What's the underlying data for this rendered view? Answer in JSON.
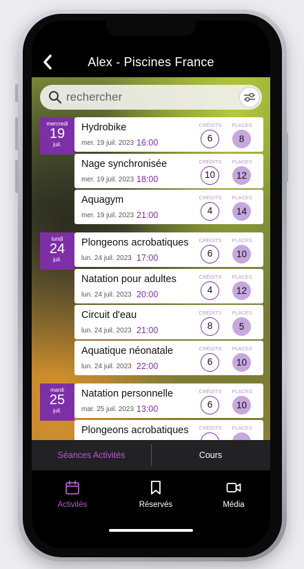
{
  "app": {
    "title": "Alex - Piscines France"
  },
  "search": {
    "placeholder": "rechercher",
    "value": ""
  },
  "labels": {
    "credits": "CRÉDITS",
    "places": "PLACES"
  },
  "days": [
    {
      "dow": "mercredi",
      "day": "19",
      "month": "juil.",
      "sessions": [
        {
          "name": "Hydrobike",
          "date": "mer. 19 juil. 2023",
          "time": "16:00",
          "credits": "6",
          "places": "8"
        },
        {
          "name": "Nage synchronisée",
          "date": "mer. 19 juil. 2023",
          "time": "18:00",
          "credits": "10",
          "places": "12"
        },
        {
          "name": "Aquagym",
          "date": "mer. 19 juil. 2023",
          "time": "21:00",
          "credits": "4",
          "places": "14"
        }
      ]
    },
    {
      "dow": "lundi",
      "day": "24",
      "month": "juil.",
      "sessions": [
        {
          "name": "Plongeons acrobatiques",
          "date": "lun. 24 juil. 2023",
          "time": "17:00",
          "credits": "6",
          "places": "10"
        },
        {
          "name": "Natation pour adultes",
          "date": "lun. 24 juil. 2023",
          "time": "20:00",
          "credits": "4",
          "places": "12"
        },
        {
          "name": "Circuit d'eau",
          "date": "lun. 24 juil. 2023",
          "time": "21:00",
          "credits": "8",
          "places": "5"
        },
        {
          "name": "Aquatique néonatale",
          "date": "lun. 24 juil. 2023",
          "time": "22:00",
          "credits": "6",
          "places": "10"
        }
      ]
    },
    {
      "dow": "mardi",
      "day": "25",
      "month": "juil.",
      "sessions": [
        {
          "name": "Natation personnelle",
          "date": "mar. 25 juil. 2023",
          "time": "13:00",
          "credits": "6",
          "places": "10"
        },
        {
          "name": "Plongeons acrobatiques",
          "date": "",
          "time": "",
          "credits": "",
          "places": ""
        }
      ]
    }
  ],
  "tabs": [
    {
      "label": "Séances Activités",
      "active": true
    },
    {
      "label": "Cours",
      "active": false
    }
  ],
  "bottom_nav": [
    {
      "label": "Activités",
      "icon": "calendar-icon",
      "active": true
    },
    {
      "label": "Réservés",
      "icon": "bookmark-icon",
      "active": false
    },
    {
      "label": "Média",
      "icon": "video-camera-icon",
      "active": false
    }
  ],
  "colors": {
    "accent": "#7d2fa6",
    "accent_light": "#b458d4",
    "places_fill": "#c6a7de"
  }
}
